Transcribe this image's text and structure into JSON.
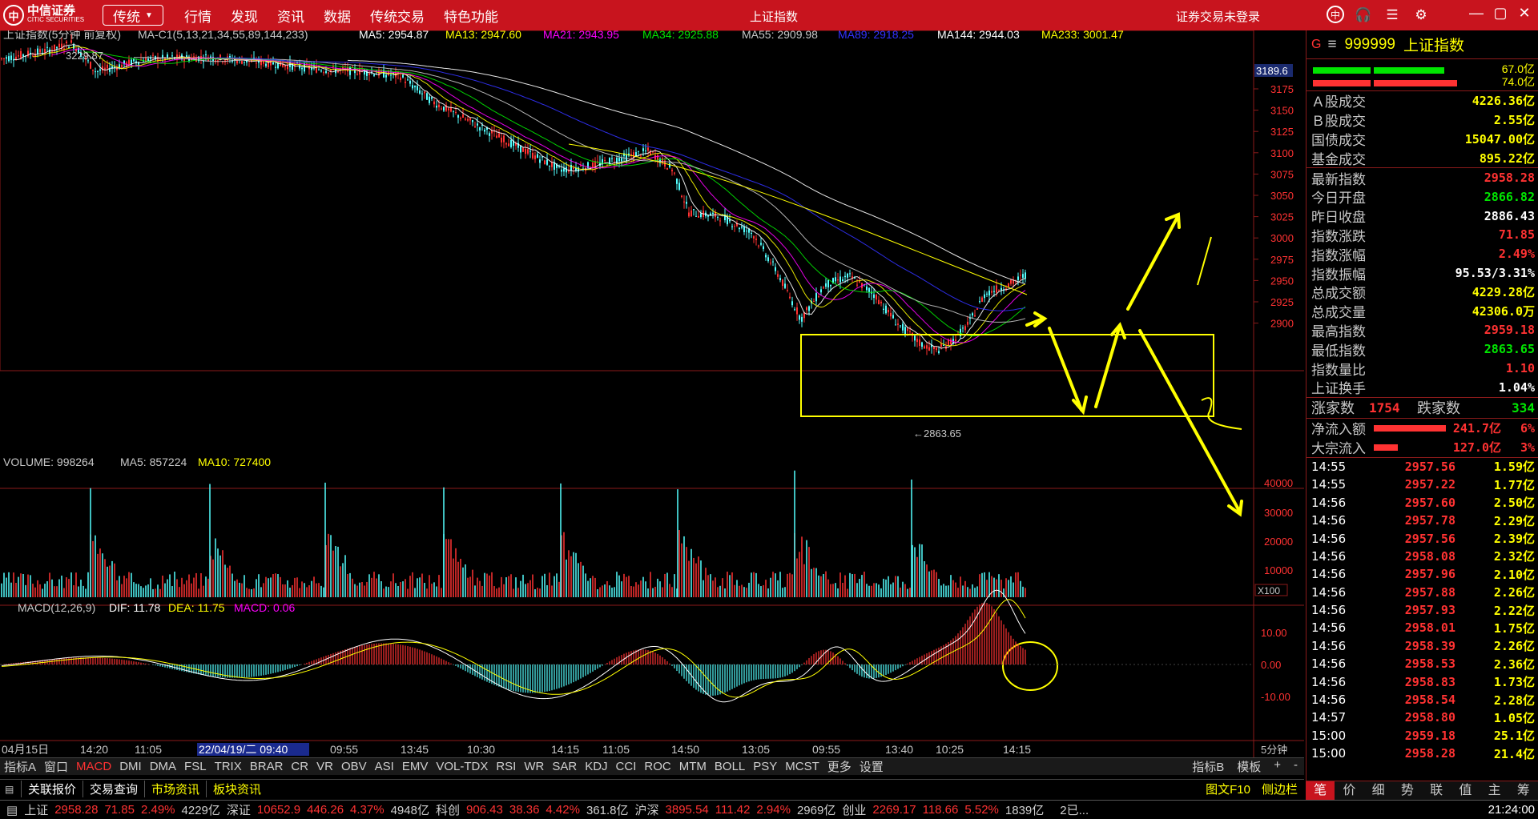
{
  "titlebar": {
    "logo_cn": "中信证券",
    "logo_en": "CITIC SECURITIES",
    "mode": "传统",
    "nav": [
      "行情",
      "发现",
      "资讯",
      "数据",
      "传统交易",
      "特色功能"
    ],
    "window_title": "上证指数",
    "login_status": "证券交易未登录",
    "icons": [
      "logo-circle-icon",
      "headset-icon",
      "list-icon",
      "gear-icon"
    ],
    "win_controls": [
      "—",
      "▢",
      "✕"
    ]
  },
  "main_chart": {
    "title": "上证指数(5分钟 前复权)",
    "ma_header": "MA-C1(5,13,21,34,55,89,144,233)",
    "ma_values": [
      {
        "label": "MA5: 2954.87",
        "color": "#ffffff"
      },
      {
        "label": "MA13: 2947.60",
        "color": "#ffff00"
      },
      {
        "label": "MA21: 2943.95",
        "color": "#ff00ff"
      },
      {
        "label": "MA34: 2925.88",
        "color": "#00e600"
      },
      {
        "label": "MA55: 2909.98",
        "color": "#c8c8c8"
      },
      {
        "label": "MA89: 2918.25",
        "color": "#3232ff"
      },
      {
        "label": "MA144: 2944.03",
        "color": "#ffffff"
      },
      {
        "label": "MA233: 3001.47",
        "color": "#ffff00"
      }
    ],
    "price_ticks": [
      "3175",
      "3150",
      "3125",
      "3100",
      "3075",
      "3050",
      "3025",
      "3000",
      "2975",
      "2950",
      "2925",
      "2900"
    ],
    "current_price_tag": "3189.6",
    "high_label": "3229.87",
    "low_label": "←2863.65"
  },
  "volume_chart": {
    "header": "VOLUME: 998264",
    "ma5": "MA5: 857224",
    "ma10": "MA10: 727400",
    "ticks": [
      "40000",
      "30000",
      "20000",
      "10000"
    ],
    "unit": "X100"
  },
  "macd_chart": {
    "header": "MACD(12,26,9)",
    "dif": "DIF: 11.78",
    "dea": "DEA: 11.75",
    "macd": "MACD: 0.06",
    "ticks": [
      "10.00",
      "0.00",
      "-10.00"
    ]
  },
  "time_axis": {
    "labels": [
      "04月15日",
      "14:20",
      "11:05",
      "22/04/19/二 09:40",
      "09:55",
      "13:45",
      "10:30",
      "14:15",
      "11:05",
      "14:50",
      "13:05",
      "09:55",
      "13:40",
      "10:25",
      "14:15"
    ],
    "period": "5分钟"
  },
  "indicator_tabs": {
    "items": [
      "指标A",
      "窗口",
      "MACD",
      "DMI",
      "DMA",
      "FSL",
      "TRIX",
      "BRAR",
      "CR",
      "VR",
      "OBV",
      "ASI",
      "EMV",
      "VOL-TDX",
      "RSI",
      "WR",
      "SAR",
      "KDJ",
      "CCI",
      "ROC",
      "MTM",
      "BOLL",
      "PSY",
      "MCST",
      "更多",
      "设置"
    ],
    "active": "MACD",
    "right": [
      "指标B",
      "模板",
      "+",
      "-"
    ]
  },
  "quick_tabs": {
    "items": [
      "关联报价",
      "交易查询",
      "市场资讯",
      "板块资讯"
    ],
    "right": [
      "图文F10",
      "侧边栏"
    ]
  },
  "right_panel": {
    "header": {
      "g": "G",
      "menu": "≡",
      "code": "999999",
      "name": "上证指数"
    },
    "bar_values": [
      "67.0亿",
      "74.0亿"
    ],
    "volumes": [
      {
        "k": "Ａ股成交",
        "v": "4226.36亿"
      },
      {
        "k": "Ｂ股成交",
        "v": "2.55亿"
      },
      {
        "k": "国债成交",
        "v": "15047.00亿"
      },
      {
        "k": "基金成交",
        "v": "895.22亿"
      }
    ],
    "stats": [
      {
        "k": "最新指数",
        "v": "2958.28",
        "c": "red"
      },
      {
        "k": "今日开盘",
        "v": "2866.82",
        "c": "green"
      },
      {
        "k": "昨日收盘",
        "v": "2886.43",
        "c": "white"
      },
      {
        "k": "指数涨跌",
        "v": "71.85",
        "c": "red"
      },
      {
        "k": "指数涨幅",
        "v": "2.49%",
        "c": "red"
      },
      {
        "k": "指数振幅",
        "v": "95.53/3.31%",
        "c": "white"
      },
      {
        "k": "总成交额",
        "v": "4229.28亿",
        "c": "yellow"
      },
      {
        "k": "总成交量",
        "v": "42306.0万",
        "c": "yellow"
      },
      {
        "k": "最高指数",
        "v": "2959.18",
        "c": "red"
      },
      {
        "k": "最低指数",
        "v": "2863.65",
        "c": "green"
      },
      {
        "k": "指数量比",
        "v": "1.10",
        "c": "red"
      },
      {
        "k": "上证换手",
        "v": "1.04%",
        "c": "white"
      }
    ],
    "updown": {
      "up_label": "涨家数",
      "up": "1754",
      "down_label": "跌家数",
      "down": "334"
    },
    "flows": [
      {
        "k": "净流入额",
        "v": "241.7亿",
        "p": "6%"
      },
      {
        "k": "大宗流入",
        "v": "127.0亿",
        "p": "3%"
      }
    ],
    "ticks": [
      {
        "t": "14:55",
        "p": "2957.56",
        "a": "1.59亿"
      },
      {
        "t": "14:55",
        "p": "2957.22",
        "a": "1.77亿"
      },
      {
        "t": "14:56",
        "p": "2957.60",
        "a": "2.50亿"
      },
      {
        "t": "14:56",
        "p": "2957.78",
        "a": "2.29亿"
      },
      {
        "t": "14:56",
        "p": "2957.56",
        "a": "2.39亿"
      },
      {
        "t": "14:56",
        "p": "2958.08",
        "a": "2.32亿"
      },
      {
        "t": "14:56",
        "p": "2957.96",
        "a": "2.10亿"
      },
      {
        "t": "14:56",
        "p": "2957.88",
        "a": "2.26亿"
      },
      {
        "t": "14:56",
        "p": "2957.93",
        "a": "2.22亿"
      },
      {
        "t": "14:56",
        "p": "2958.01",
        "a": "1.75亿"
      },
      {
        "t": "14:56",
        "p": "2958.39",
        "a": "2.26亿"
      },
      {
        "t": "14:56",
        "p": "2958.53",
        "a": "2.36亿"
      },
      {
        "t": "14:56",
        "p": "2958.83",
        "a": "1.73亿"
      },
      {
        "t": "14:56",
        "p": "2958.54",
        "a": "2.28亿"
      },
      {
        "t": "14:57",
        "p": "2958.80",
        "a": "1.05亿"
      },
      {
        "t": "15:00",
        "p": "2959.18",
        "a": "25.1亿"
      },
      {
        "t": "15:00",
        "p": "2958.28",
        "a": "21.4亿"
      }
    ],
    "tabs": [
      "笔",
      "价",
      "细",
      "势",
      "联",
      "值",
      "主",
      "筹"
    ]
  },
  "statusbar": {
    "items": [
      {
        "name": "上证",
        "vals": [
          "2958.28",
          "71.85",
          "2.49%"
        ],
        "amt": "4229亿"
      },
      {
        "name": "深证",
        "vals": [
          "10652.9",
          "446.26",
          "4.37%"
        ],
        "amt": "4948亿"
      },
      {
        "name": "科创",
        "vals": [
          "906.43",
          "38.36",
          "4.42%"
        ],
        "amt": "361.8亿"
      },
      {
        "name": "沪深",
        "vals": [
          "3895.54",
          "111.42",
          "2.94%"
        ],
        "amt": "2969亿"
      },
      {
        "name": "创业",
        "vals": [
          "2269.17",
          "118.66",
          "5.52%"
        ],
        "amt": "1839亿"
      }
    ],
    "extra": "2已...",
    "clock": "21:24:00"
  },
  "annotation_colors": {
    "box": "#ffff00",
    "arrow": "#ffff00"
  }
}
